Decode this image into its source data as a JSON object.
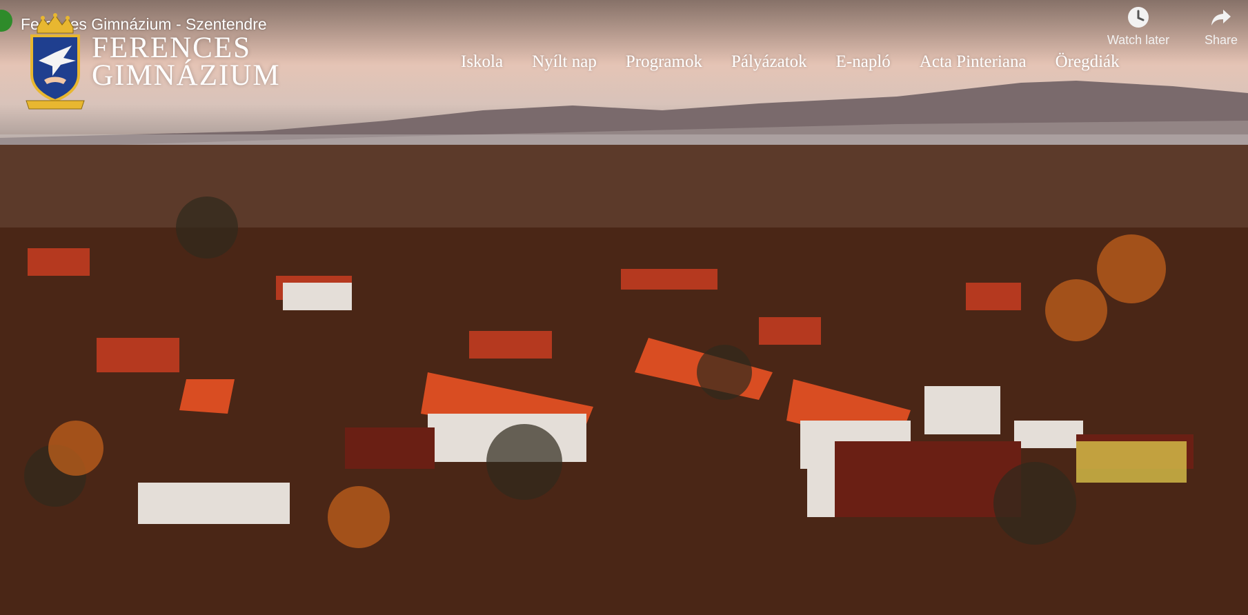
{
  "video": {
    "title": "Ferences Gimnázium - Szentendre",
    "actions": {
      "watch_later": "Watch later",
      "share": "Share"
    }
  },
  "site": {
    "brand_line1": "FERENCES",
    "brand_line2": "GIMNÁZIUM",
    "nav": [
      "Iskola",
      "Nyílt nap",
      "Programok",
      "Pályázatok",
      "E-napló",
      "Acta Pinteriana",
      "Öregdiák"
    ]
  },
  "colors": {
    "accent_green": "#2e8b2a",
    "logo_blue": "#1f3f8f",
    "logo_gold": "#e8b730"
  },
  "icons": [
    "clock-icon",
    "share-arrow-icon",
    "crest-logo"
  ]
}
